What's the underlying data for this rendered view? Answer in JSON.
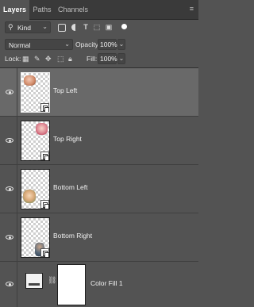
{
  "tabs": [
    {
      "label": "Layers",
      "active": true
    },
    {
      "label": "Paths",
      "active": false
    },
    {
      "label": "Channels",
      "active": false
    }
  ],
  "filter": {
    "kind_label": "Kind"
  },
  "blend": {
    "mode": "Normal",
    "opacity_label": "Opacity:",
    "opacity_value": "100%"
  },
  "lock": {
    "label": "Lock:",
    "fill_label": "Fill:",
    "fill_value": "100%"
  },
  "layers": [
    {
      "name": "Top Left",
      "visible": true,
      "selected": true,
      "type": "smart-object"
    },
    {
      "name": "Top Right",
      "visible": true,
      "selected": false,
      "type": "smart-object"
    },
    {
      "name": "Bottom Left",
      "visible": true,
      "selected": false,
      "type": "smart-object"
    },
    {
      "name": "Bottom Right",
      "visible": true,
      "selected": false,
      "type": "smart-object"
    },
    {
      "name": "Color Fill 1",
      "visible": true,
      "selected": false,
      "type": "fill-layer"
    }
  ],
  "colors": {
    "panel": "#535353",
    "tabbar": "#3a3a3a",
    "selected_row": "#696969"
  }
}
